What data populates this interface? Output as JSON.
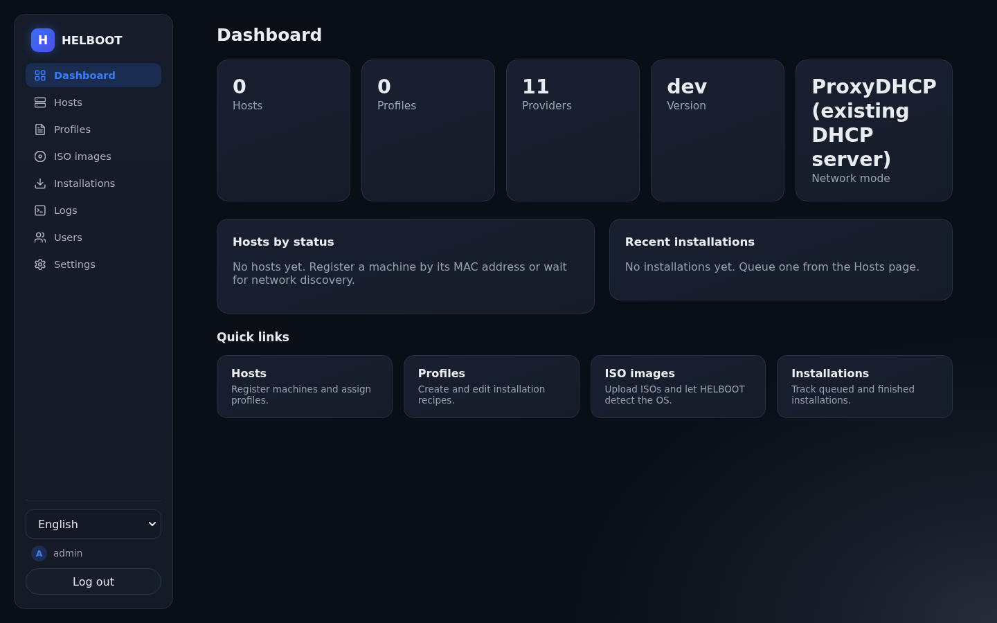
{
  "sidebar": {
    "logo": "H",
    "brand": "HELBOOT",
    "items": [
      {
        "kind": "dashboard",
        "label": "Dashboard",
        "selected": true
      },
      {
        "kind": "hosts",
        "label": "Hosts",
        "selected": false
      },
      {
        "kind": "profiles",
        "label": "Profiles",
        "selected": false
      },
      {
        "kind": "iso",
        "label": "ISO images",
        "selected": false
      },
      {
        "kind": "installations",
        "label": "Installations",
        "selected": false
      },
      {
        "kind": "logs",
        "label": "Logs",
        "selected": false
      },
      {
        "kind": "users",
        "label": "Users",
        "selected": false
      },
      {
        "kind": "settings",
        "label": "Settings",
        "selected": false
      }
    ],
    "language_select": {
      "value": "English"
    },
    "user": {
      "avatar": "A",
      "name": "admin"
    },
    "logout_button": "Log out"
  },
  "page": {
    "title": "Dashboard"
  },
  "stats": [
    {
      "value": "0",
      "label": "Hosts"
    },
    {
      "value": "0",
      "label": "Profiles"
    },
    {
      "value": "11",
      "label": "Providers"
    },
    {
      "value": "dev",
      "label": "Version"
    },
    {
      "value": "ProxyDHCP (existing DHCP server)",
      "label": "Network mode"
    }
  ],
  "panels": [
    {
      "title": "Hosts by status",
      "text": "No hosts yet. Register a machine by its MAC address or wait for network discovery."
    },
    {
      "title": "Recent installations",
      "text": "No installations yet. Queue one from the Hosts page."
    }
  ],
  "quick_links": {
    "title": "Quick links",
    "items": [
      {
        "title": "Hosts",
        "description": "Register machines and assign profiles."
      },
      {
        "title": "Profiles",
        "description": "Create and edit installation recipes."
      },
      {
        "title": "ISO images",
        "description": "Upload ISOs and let HELBOOT detect the OS."
      },
      {
        "title": "Installations",
        "description": "Track queued and finished installations."
      }
    ]
  }
}
